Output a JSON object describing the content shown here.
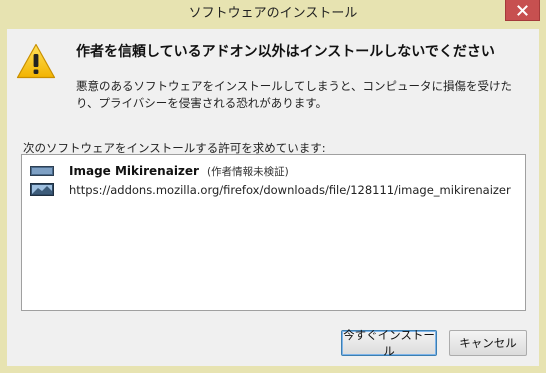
{
  "window": {
    "title": "ソフトウェアのインストール"
  },
  "dialog": {
    "headline": "作者を信頼しているアドオン以外はインストールしないでください",
    "description": "悪意のあるソフトウェアをインストールしてしまうと、コンピュータに損傷を受けたり、プライバシーを侵害される恐れがあります。",
    "list_label": "次のソフトウェアをインストールする許可を求めています:"
  },
  "addons": [
    {
      "name": "Image Mikirenaizer",
      "status": "(作者情報未検証)",
      "url": "https://addons.mozilla.org/firefox/downloads/file/128111/image_mikirenaizer",
      "icon": "image-icon"
    }
  ],
  "buttons": {
    "install_label": "今すぐインストール",
    "cancel_label": "キャンセル"
  },
  "colors": {
    "frame": "#e7e3b1",
    "close": "#c75050",
    "client": "#f0f0f0",
    "warning": "#f5c400"
  }
}
